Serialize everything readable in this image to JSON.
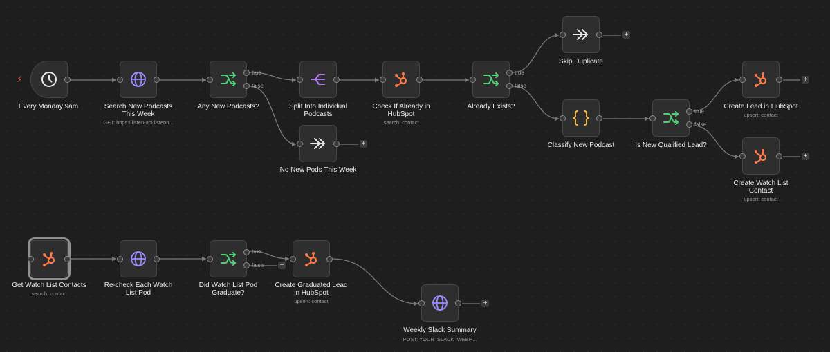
{
  "trigger_icon": "lightning-bolt-icon",
  "nodes": {
    "every_monday": {
      "label": "Every Monday 9am",
      "icon": "clock-icon"
    },
    "search_podcasts": {
      "label": "Search New Podcasts\nThis Week",
      "sub": "GET: https://listen-api.listenn...",
      "icon": "globe-icon"
    },
    "any_new_podcasts": {
      "label": "Any New Podcasts?",
      "icon": "branch-icon",
      "true": "true",
      "false": "false"
    },
    "split_individual": {
      "label": "Split Into Individual\nPodcasts",
      "icon": "split-icon"
    },
    "no_new_pods": {
      "label": "No New Pods This Week",
      "icon": "noop-arrow-icon"
    },
    "check_hubspot": {
      "label": "Check If Already in\nHubSpot",
      "sub": "search: contact",
      "icon": "hubspot-icon"
    },
    "already_exists": {
      "label": "Already Exists?",
      "icon": "branch-icon",
      "true": "true",
      "false": "false"
    },
    "skip_duplicate": {
      "label": "Skip Duplicate",
      "icon": "noop-arrow-icon"
    },
    "classify_podcast": {
      "label": "Classify New Podcast",
      "icon": "code-braces-icon"
    },
    "is_qualified": {
      "label": "Is New Qualified Lead?",
      "icon": "branch-icon",
      "true": "true",
      "false": "false"
    },
    "create_lead": {
      "label": "Create Lead in HubSpot",
      "sub": "upsert: contact",
      "icon": "hubspot-icon"
    },
    "create_watch": {
      "label": "Create Watch List\nContact",
      "sub": "upsert: contact",
      "icon": "hubspot-icon"
    },
    "get_watch": {
      "label": "Get Watch List Contacts",
      "sub": "search: contact",
      "icon": "hubspot-icon"
    },
    "recheck_pod": {
      "label": "Re-check Each Watch\nList Pod",
      "icon": "globe-icon"
    },
    "did_graduate": {
      "label": "Did Watch List Pod\nGraduate?",
      "icon": "branch-icon",
      "true": "true",
      "false": "false"
    },
    "create_graduated": {
      "label": "Create Graduated Lead\nin HubSpot",
      "sub": "upsert: contact",
      "icon": "hubspot-icon"
    },
    "slack_summary": {
      "label": "Weekly Slack Summary",
      "sub": "POST: YOUR_SLACK_WEBH...",
      "icon": "globe-icon"
    }
  },
  "add_button_label": "+",
  "colors": {
    "background": "#1e1e1f",
    "node_fill": "#2e2e2f",
    "node_border": "#454547",
    "wire": "#7a7a7c",
    "hubspot": "#ff7a45",
    "globe": "#9b8cff",
    "branch": "#4fd17a",
    "split": "#b07cf0",
    "code": "#f5b94a",
    "trigger_bolt": "#ff6d4a"
  }
}
